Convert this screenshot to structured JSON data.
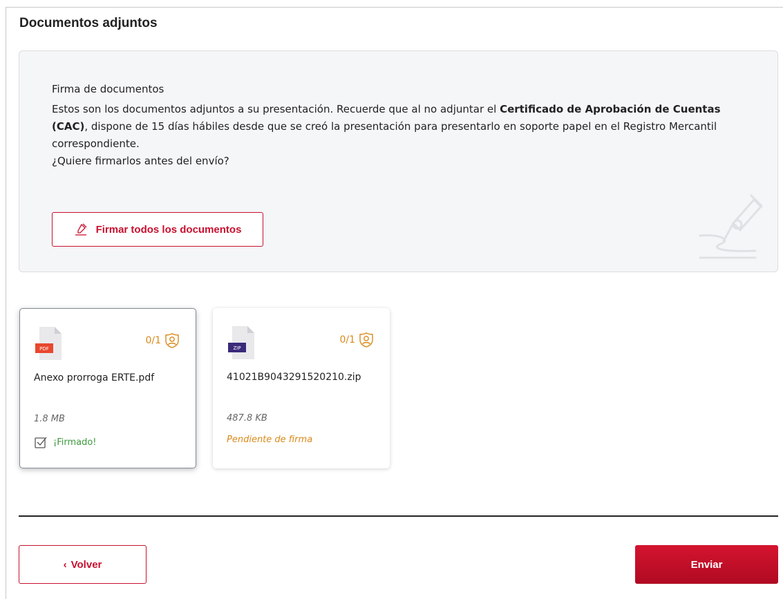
{
  "section": {
    "title": "Documentos adjuntos"
  },
  "info": {
    "title": "Firma de documentos",
    "text_before": "Estos son los documentos adjuntos a su presentación. Recuerde que al no adjuntar el ",
    "text_bold": "Certificado de Aprobación de Cuentas (CAC)",
    "text_after": ", dispone de 15 días hábiles desde que se creó la presentación para presentarlo en soporte papel en el Registro Mercantil correspondiente.",
    "question": "¿Quiere firmarlos antes del envío?",
    "sign_all_label": "Firmar todos los documentos",
    "icons": {
      "sign_all": "signature-pen-icon",
      "watermark": "signature-pen-watermark-icon"
    }
  },
  "documents": [
    {
      "type_label": "PDF",
      "type_color": "#e8472e",
      "signers": "0/1",
      "name": "Anexo prorroga ERTE.pdf",
      "size": "1.8 MB",
      "status": "¡Firmado!",
      "status_kind": "signed",
      "status_color": "#3d9a3d",
      "selected": true
    },
    {
      "type_label": "ZIP",
      "type_color": "#3b2a7a",
      "signers": "0/1",
      "name": "41021B9043291520210.zip",
      "size": "487.8 KB",
      "status": "Pendiente de firma",
      "status_kind": "pending",
      "status_color": "#d98a1b",
      "selected": false
    }
  ],
  "footer": {
    "back_label": "Volver",
    "back_chevron": "‹",
    "send_label": "Enviar"
  },
  "colors": {
    "accent": "#c8102e",
    "signer_icon": "#d98a1b"
  }
}
